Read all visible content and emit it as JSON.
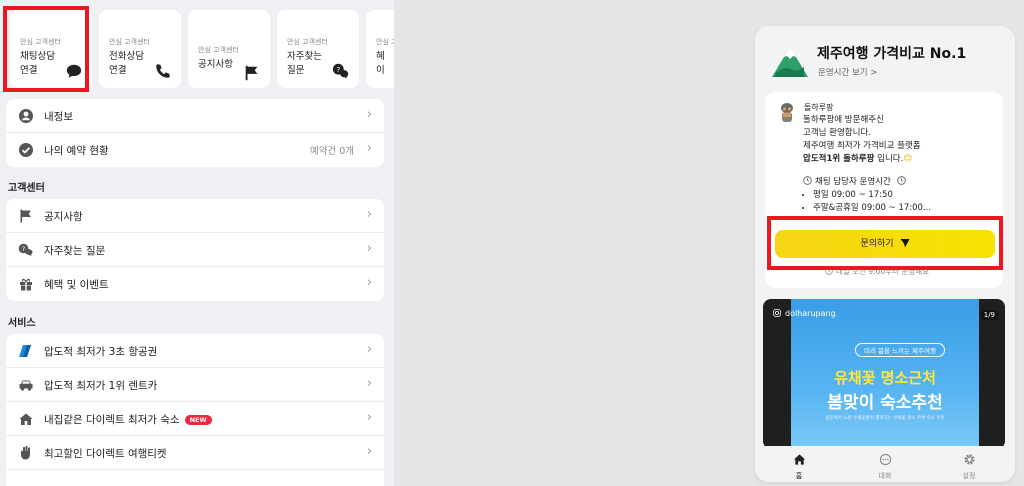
{
  "colors": {
    "accent_yellow": "#f5e300",
    "highlight_red": "#e8191f",
    "new_badge": "#f0263b",
    "brand_green": "#2fa06a"
  },
  "top_cards": [
    {
      "sub": "안심 고객센터",
      "main": "채팅상담\n연결",
      "icon": "chat-bubble-icon"
    },
    {
      "sub": "안심 고객센터",
      "main": "전화상담\n연결",
      "icon": "phone-icon"
    },
    {
      "sub": "안심 고객센터",
      "main": "공지사항",
      "icon": "flag-icon"
    },
    {
      "sub": "안심 고객센터",
      "main": "자주찾는\n질문",
      "icon": "faq-bubbles-icon"
    },
    {
      "sub": "안심 고객센터",
      "main": "혜\n이",
      "icon": ""
    }
  ],
  "account": {
    "items": [
      {
        "label": "내정보",
        "icon": "user-circle-icon"
      },
      {
        "label": "나의 예약 현황",
        "icon": "check-circle-icon",
        "extra": "예약건 0개"
      }
    ]
  },
  "support": {
    "title": "고객센터",
    "items": [
      {
        "label": "공지사항",
        "icon": "flag-icon"
      },
      {
        "label": "자주찾는 질문",
        "icon": "faq-bubbles-icon"
      },
      {
        "label": "혜택 및 이벤트",
        "icon": "gift-icon"
      }
    ]
  },
  "service": {
    "title": "서비스",
    "items": [
      {
        "label": "압도적 최저가 3초 항공권",
        "icon": "airline-ticket-icon"
      },
      {
        "label": "압도적 최저가 1위 렌트카",
        "icon": "car-icon"
      },
      {
        "label": "내집같은 다이렉트 최저가 숙소",
        "icon": "house-icon",
        "badge": "NEW"
      },
      {
        "label": "최고할인 다이렉트 여행티켓",
        "icon": "hand-ticket-icon"
      }
    ]
  },
  "widget": {
    "title": "제주여행 가격비교 No.1",
    "hours_link": "운영시간 보기 >",
    "bot_name": "돌하루팡",
    "msg_line1": "돌하루팡에 방문해주신",
    "msg_line2": "고객님 환영합니다.",
    "msg_line3": "제주여행 최저가 가격비교 플랫폼",
    "msg_bold": "압도적1위 돌하루팡",
    "msg_tail": " 입니다.",
    "msg_emoji": "😊",
    "hours_title": "채팅 담당자 운영시간",
    "hours_weekday": "평일 09:00 ~ 17:50",
    "hours_weekend": "주말&공휴일 09:00 ~ 17:00...",
    "inquiry_button": "문의하기",
    "notice": "내일 오전 9:00부터 운영해요",
    "post": {
      "user": "dolharupang",
      "count": "1/9",
      "pill": "미리 봄을 느끼는 제주여행",
      "headline1": "유채꽃 명소근처",
      "headline2": "봄맞이 숙소추천",
      "small_text": "봄뜻에서 노란 유채꽃밭이 펼쳐지는 유채꽃 명소 주변 숙소 추천"
    },
    "tabs": [
      {
        "label": "홈",
        "icon": "home-icon"
      },
      {
        "label": "대화",
        "icon": "chat-icon"
      },
      {
        "label": "설정",
        "icon": "gear-icon"
      }
    ]
  }
}
